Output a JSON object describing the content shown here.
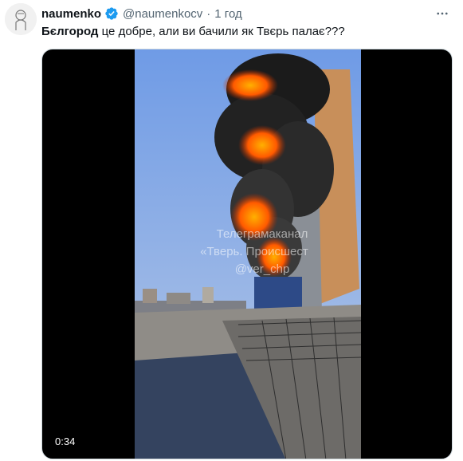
{
  "tweet": {
    "author_name": "naumenko",
    "handle": "@naumenkocv",
    "separator": "·",
    "time": "1 год",
    "text_bold": "Бєлгород",
    "text_rest": " це добре, али ви бачили як Твєрь палає???"
  },
  "media": {
    "duration": "0:34",
    "watermark_line1": "Телеграмаканал",
    "watermark_line2": "«Тверь. Происшест",
    "watermark_line3": "@ver_chp"
  },
  "icons": {
    "verified": "verified-badge-icon",
    "more": "more-dots-icon",
    "avatar": "avatar-sketch"
  },
  "colors": {
    "verified": "#1d9bf0",
    "secondary_text": "#536471",
    "media_border": "#cfd9de"
  }
}
